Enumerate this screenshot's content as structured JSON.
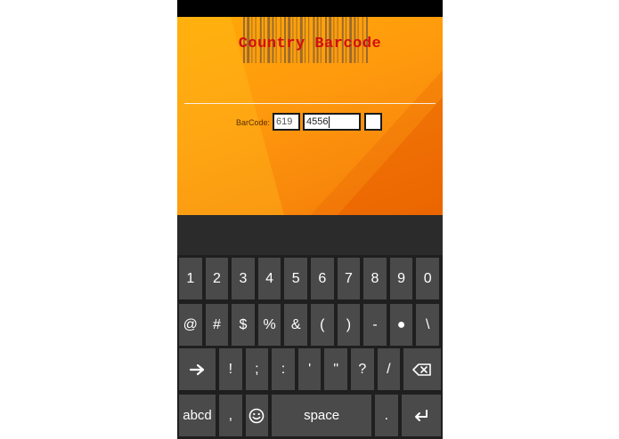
{
  "app": {
    "title": "Country Barcode",
    "barcode_label": "BarCode:",
    "fields": [
      {
        "value": "619"
      },
      {
        "value": "4556"
      },
      {
        "value": ""
      }
    ]
  },
  "keyboard": {
    "rows": [
      [
        {
          "label": "1",
          "name": "key-1"
        },
        {
          "label": "2",
          "name": "key-2"
        },
        {
          "label": "3",
          "name": "key-3"
        },
        {
          "label": "4",
          "name": "key-4"
        },
        {
          "label": "5",
          "name": "key-5"
        },
        {
          "label": "6",
          "name": "key-6"
        },
        {
          "label": "7",
          "name": "key-7"
        },
        {
          "label": "8",
          "name": "key-8"
        },
        {
          "label": "9",
          "name": "key-9"
        },
        {
          "label": "0",
          "name": "key-0"
        }
      ],
      [
        {
          "label": "@",
          "name": "key-at"
        },
        {
          "label": "#",
          "name": "key-hash"
        },
        {
          "label": "$",
          "name": "key-dollar"
        },
        {
          "label": "%",
          "name": "key-percent"
        },
        {
          "label": "&",
          "name": "key-ampersand"
        },
        {
          "label": "(",
          "name": "key-open-paren"
        },
        {
          "label": ")",
          "name": "key-close-paren"
        },
        {
          "label": "-",
          "name": "key-minus"
        },
        {
          "label": "●",
          "name": "key-bullet"
        },
        {
          "label": "\\",
          "name": "key-backslash"
        }
      ],
      [
        {
          "label": "",
          "name": "shift-key",
          "icon": "arrow-right-icon"
        },
        {
          "label": "!",
          "name": "key-exclamation"
        },
        {
          "label": ";",
          "name": "key-semicolon"
        },
        {
          "label": ":",
          "name": "key-colon"
        },
        {
          "label": "'",
          "name": "key-apostrophe"
        },
        {
          "label": "\"",
          "name": "key-quote"
        },
        {
          "label": "?",
          "name": "key-question"
        },
        {
          "label": "/",
          "name": "key-slash"
        },
        {
          "label": "",
          "name": "backspace-key",
          "icon": "backspace-icon"
        }
      ],
      [
        {
          "label": "abcd",
          "name": "abcd-key"
        },
        {
          "label": ",",
          "name": "key-comma"
        },
        {
          "label": "",
          "name": "emoji-key",
          "icon": "smiley-icon"
        },
        {
          "label": "space",
          "name": "space-key"
        },
        {
          "label": ".",
          "name": "key-period"
        },
        {
          "label": "",
          "name": "enter-key",
          "icon": "enter-icon"
        }
      ]
    ]
  },
  "colors": {
    "title": "#d20f0f",
    "key_bg": "#4a4a4a",
    "keyboard_bg": "#1f1f1f",
    "accent_orange": "#ff9a0c"
  }
}
